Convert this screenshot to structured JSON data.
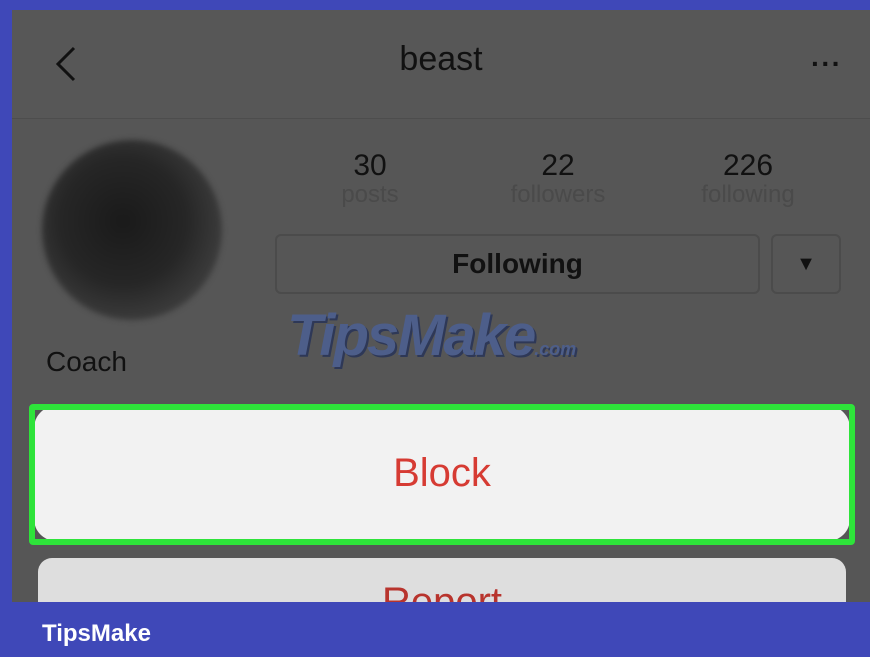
{
  "header": {
    "title": "beast",
    "back_icon": "chevron-left-icon",
    "more_icon": "more-dots-icon",
    "more_label": "···"
  },
  "profile": {
    "display_name": "Coach",
    "stats": [
      {
        "value": "30",
        "label": "posts"
      },
      {
        "value": "22",
        "label": "followers"
      },
      {
        "value": "226",
        "label": "following"
      }
    ],
    "following_button": "Following",
    "dropdown_glyph": "▼"
  },
  "action_sheet": {
    "block_label": "Block",
    "report_label": "Report",
    "destructive_color": "#d63b33",
    "highlight_color": "#2ee33a"
  },
  "watermark": {
    "text": "TipsMake",
    "suffix": ".com"
  },
  "footer": {
    "brand": "TipsMake",
    "bar_color": "#3f48b8"
  }
}
